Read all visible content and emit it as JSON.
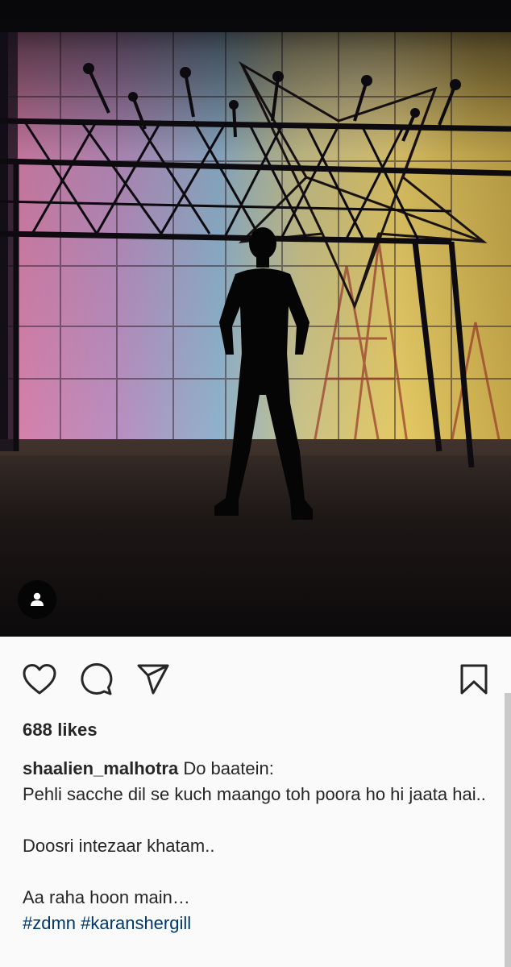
{
  "post": {
    "likes": "688 likes",
    "caption": {
      "username": "shaalien_malhotra",
      "first_line": "Do baatein:",
      "lines": [
        "Pehli sacche dil se kuch maango toh poora ho hi jaata hai..",
        "",
        "Doosri intezaar khatam..",
        "",
        "Aa raha hoon main…"
      ],
      "hashtags": [
        "#zdmn",
        "#karanshergill"
      ]
    }
  },
  "icons": {
    "tag": "person-tag-icon",
    "like": "heart-icon",
    "comment": "comment-bubble-icon",
    "share": "paper-plane-icon",
    "save": "bookmark-icon"
  },
  "colors": {
    "text": "#262626",
    "hashtag": "#00376b",
    "background": "#fafafa"
  }
}
